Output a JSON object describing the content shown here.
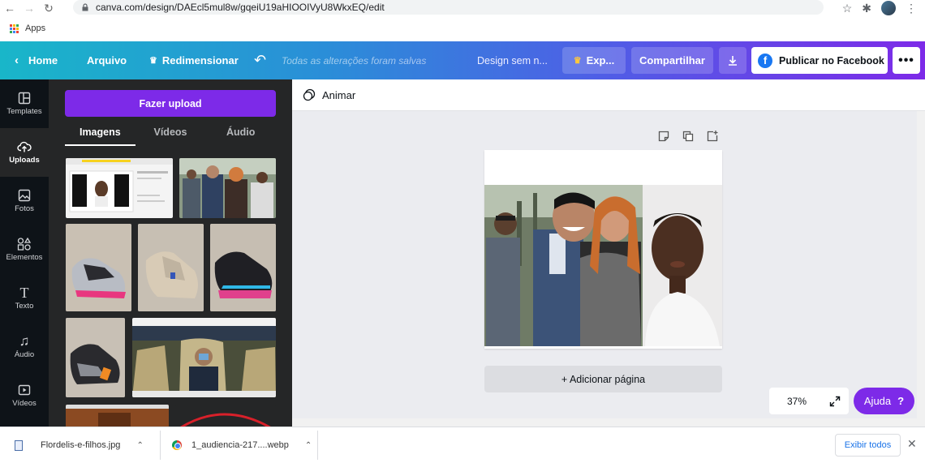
{
  "browser": {
    "url": "canva.com/design/DAEcl5mul8w/gqeiU19aHIOOIVyU8WkxEQ/edit",
    "bookmark_apps": "Apps"
  },
  "topbar": {
    "home": "Home",
    "arquivo": "Arquivo",
    "redimensionar": "Redimensionar",
    "saved_status": "Todas as alterações foram salvas",
    "design_name": "Design sem n...",
    "export": "Exp...",
    "share": "Compartilhar",
    "publish": "Publicar no Facebook",
    "more": "•••"
  },
  "rail": {
    "items": [
      {
        "label": "Templates",
        "icon": "templates-icon"
      },
      {
        "label": "Uploads",
        "icon": "upload-cloud-icon"
      },
      {
        "label": "Fotos",
        "icon": "photo-icon"
      },
      {
        "label": "Elementos",
        "icon": "elements-icon"
      },
      {
        "label": "Texto",
        "icon": "text-icon"
      },
      {
        "label": "Áudio",
        "icon": "audio-icon"
      },
      {
        "label": "Vídeos",
        "icon": "video-icon"
      }
    ]
  },
  "panel": {
    "upload_button": "Fazer upload",
    "tabs": [
      "Imagens",
      "Vídeos",
      "Áudio"
    ]
  },
  "editor": {
    "animate": "Animar",
    "add_page": "+ Adicionar página",
    "zoom": "37%",
    "help": "Ajuda",
    "help_icon": "?"
  },
  "downloads": {
    "items": [
      {
        "filename": "Flordelis-e-filhos.jpg"
      },
      {
        "filename": "1_audiencia-217....webp"
      }
    ],
    "show_all": "Exibir todos"
  },
  "colors": {
    "accent": "#7d2ae8",
    "panel_bg": "#252627",
    "rail_bg": "#0e1318",
    "editor_bg": "#ebecf0"
  }
}
